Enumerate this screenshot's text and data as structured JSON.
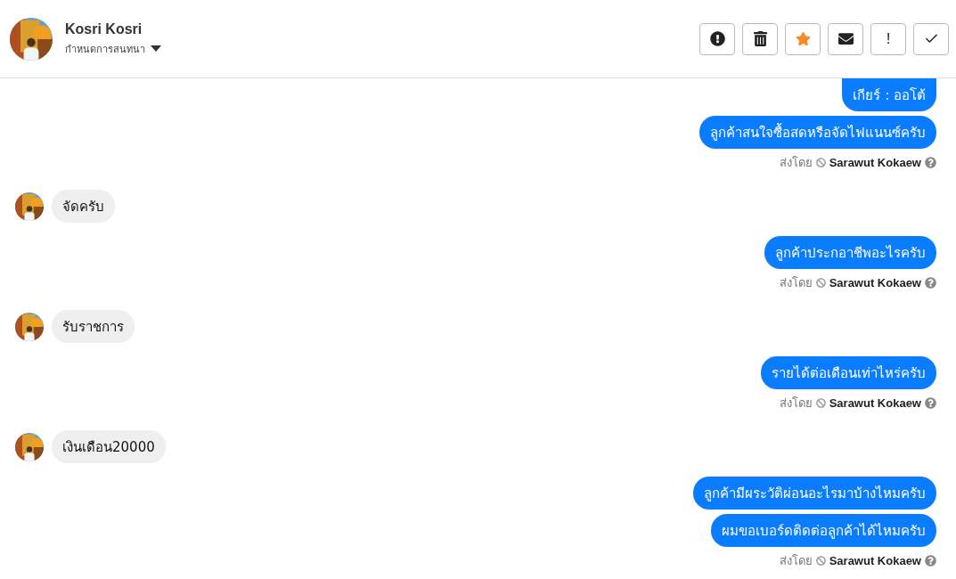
{
  "header": {
    "name": "Kosri Kosri",
    "subtitle": "กำหนดการสนทนา"
  },
  "actions": [
    {
      "kind": "alert",
      "on": false
    },
    {
      "kind": "trash",
      "on": false
    },
    {
      "kind": "star",
      "on": true
    },
    {
      "kind": "mail",
      "on": false
    },
    {
      "kind": "text",
      "label": "!",
      "on": false
    },
    {
      "kind": "check",
      "on": false
    }
  ],
  "messages": [
    {
      "kind": "outgoing",
      "cut_top": true,
      "bubbles": [
        "เกียร์ : ออโต้",
        "ลูกค้าสนใจซื้อสดหรือจัดไฟแนนซ์ครับ"
      ],
      "sent_label": "ส่งโดย",
      "sender": "Sarawut Kokaew"
    },
    {
      "kind": "incoming",
      "bubbles": [
        "จัดครับ"
      ]
    },
    {
      "kind": "outgoing",
      "cut_top": false,
      "bubbles": [
        "ลูกค้าประกอาชีพอะไรครับ"
      ],
      "sent_label": "ส่งโดย",
      "sender": "Sarawut Kokaew"
    },
    {
      "kind": "incoming",
      "bubbles": [
        "รับราชการ"
      ]
    },
    {
      "kind": "outgoing",
      "cut_top": false,
      "bubbles": [
        "รายได้ต่อเดือนเท่าไหร่ครับ"
      ],
      "sent_label": "ส่งโดย",
      "sender": "Sarawut Kokaew"
    },
    {
      "kind": "incoming",
      "bubbles": [
        "เงินเดือน20000"
      ]
    },
    {
      "kind": "outgoing",
      "cut_top": false,
      "bubbles": [
        "ลูกค้ามีผระวัติผ่อนอะไรมาบ้างไหมครับ",
        "ผมขอเบอร์ดติดต่อลูกค้าได้ไหมครับ"
      ],
      "sent_label": "ส่งโดย",
      "sender": "Sarawut Kokaew"
    }
  ]
}
